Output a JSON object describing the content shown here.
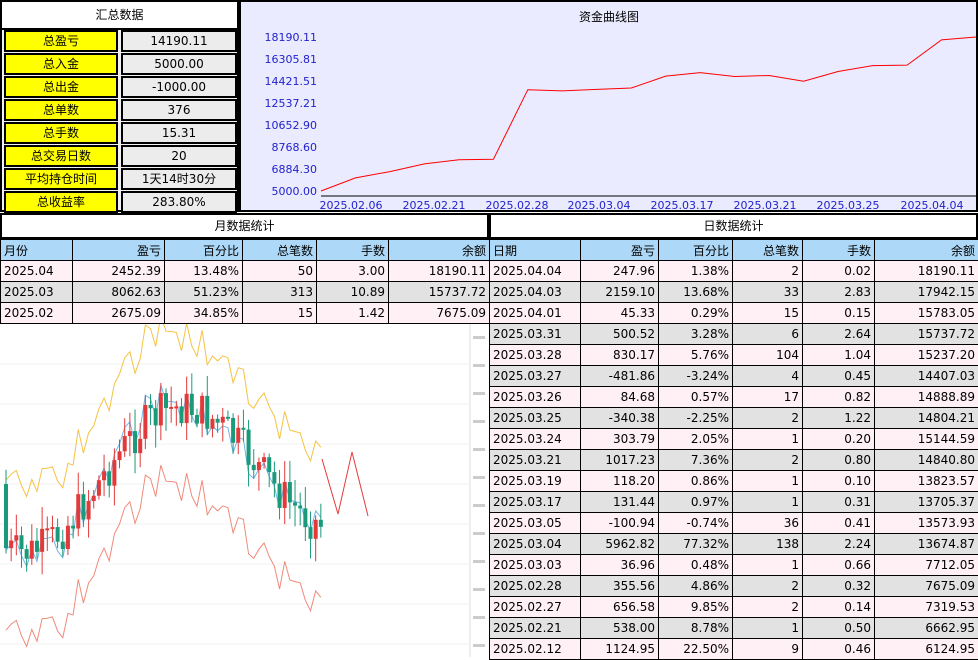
{
  "summary": {
    "title": "汇总数据",
    "rows": [
      {
        "label": "总盈亏",
        "value": "14190.11"
      },
      {
        "label": "总入金",
        "value": "5000.00"
      },
      {
        "label": "总出金",
        "value": "-1000.00"
      },
      {
        "label": "总单数",
        "value": "376"
      },
      {
        "label": "总手数",
        "value": "15.31"
      },
      {
        "label": "总交易日数",
        "value": "20"
      },
      {
        "label": "平均持仓时间",
        "value": "1天14时30分"
      },
      {
        "label": "总收益率",
        "value": "283.80%"
      }
    ]
  },
  "chart_data": {
    "type": "line",
    "title": "资金曲线图",
    "yticks": [
      "18190.11",
      "16305.81",
      "14421.51",
      "12537.21",
      "10652.90",
      "8768.60",
      "6884.30",
      "5000.00"
    ],
    "xticks": [
      "2025.02.06",
      "2025.02.21",
      "2025.02.28",
      "2025.03.04",
      "2025.03.17",
      "2025.03.21",
      "2025.03.25",
      "2025.04.04"
    ],
    "ylim": [
      5000.0,
      18190.11
    ],
    "values": [
      5000.0,
      6124.95,
      6662.95,
      7319.53,
      7675.09,
      7712.05,
      13674.87,
      13573.93,
      13705.37,
      13823.57,
      14840.8,
      15144.59,
      14804.21,
      14888.89,
      14407.03,
      15237.2,
      15737.72,
      15783.05,
      17942.15,
      18190.11
    ],
    "line_color": "#ff0000",
    "grid": false
  },
  "monthly": {
    "title": "月数据统计",
    "headers": [
      "月份",
      "盈亏",
      "百分比",
      "总笔数",
      "手数",
      "余额"
    ],
    "rows": [
      [
        "2025.04",
        "2452.39",
        "13.48%",
        "50",
        "3.00",
        "18190.11"
      ],
      [
        "2025.03",
        "8062.63",
        "51.23%",
        "313",
        "10.89",
        "15737.72"
      ],
      [
        "2025.02",
        "2675.09",
        "34.85%",
        "15",
        "1.42",
        "7675.09"
      ]
    ]
  },
  "daily": {
    "title": "日数据统计",
    "headers": [
      "日期",
      "盈亏",
      "百分比",
      "总笔数",
      "手数",
      "余额"
    ],
    "rows": [
      [
        "2025.04.04",
        "247.96",
        "1.38%",
        "2",
        "0.02",
        "18190.11"
      ],
      [
        "2025.04.03",
        "2159.10",
        "13.68%",
        "33",
        "2.83",
        "17942.15"
      ],
      [
        "2025.04.01",
        "45.33",
        "0.29%",
        "15",
        "0.15",
        "15783.05"
      ],
      [
        "2025.03.31",
        "500.52",
        "3.28%",
        "6",
        "2.64",
        "15737.72"
      ],
      [
        "2025.03.28",
        "830.17",
        "5.76%",
        "104",
        "1.04",
        "15237.20"
      ],
      [
        "2025.03.27",
        "-481.86",
        "-3.24%",
        "4",
        "0.45",
        "14407.03"
      ],
      [
        "2025.03.26",
        "84.68",
        "0.57%",
        "17",
        "0.82",
        "14888.89"
      ],
      [
        "2025.03.25",
        "-340.38",
        "-2.25%",
        "2",
        "1.22",
        "14804.21"
      ],
      [
        "2025.03.24",
        "303.79",
        "2.05%",
        "1",
        "0.20",
        "15144.59"
      ],
      [
        "2025.03.21",
        "1017.23",
        "7.36%",
        "2",
        "0.80",
        "14840.80"
      ],
      [
        "2025.03.19",
        "118.20",
        "0.86%",
        "1",
        "0.10",
        "13823.57"
      ],
      [
        "2025.03.17",
        "131.44",
        "0.97%",
        "1",
        "0.31",
        "13705.37"
      ],
      [
        "2025.03.05",
        "-100.94",
        "-0.74%",
        "36",
        "0.41",
        "13573.93"
      ],
      [
        "2025.03.04",
        "5962.82",
        "77.32%",
        "138",
        "2.24",
        "13674.87"
      ],
      [
        "2025.03.03",
        "36.96",
        "0.48%",
        "1",
        "0.66",
        "7712.05"
      ],
      [
        "2025.02.28",
        "355.56",
        "4.86%",
        "2",
        "0.32",
        "7675.09"
      ],
      [
        "2025.02.27",
        "656.58",
        "9.85%",
        "2",
        "0.14",
        "7319.53"
      ],
      [
        "2025.02.21",
        "538.00",
        "8.78%",
        "1",
        "0.50",
        "6662.95"
      ],
      [
        "2025.02.12",
        "1124.95",
        "22.50%",
        "9",
        "0.46",
        "6124.95"
      ]
    ]
  },
  "kline_colors": {
    "up": "#e23a3a",
    "down": "#1a9a7a",
    "band_upper": "#f5c242",
    "band_mid": "#6fb7e8",
    "band_lower": "#f08a7a"
  }
}
